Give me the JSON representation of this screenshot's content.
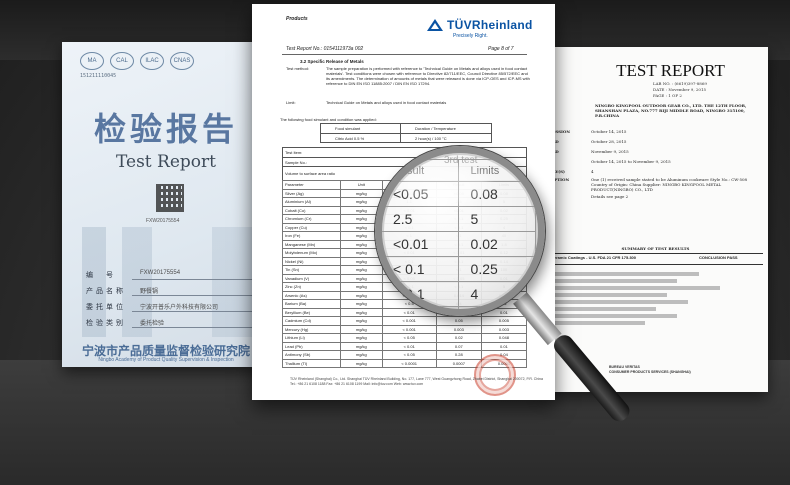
{
  "left_doc": {
    "ma_text": "151211110045",
    "logos": [
      "MA",
      "CAL",
      "ILAC",
      "CNAS"
    ],
    "title_cn": "检验报告",
    "title_en": "Test Report",
    "qr_code": "FXW20175554",
    "form": [
      {
        "label": "编　号",
        "value": "FXW20175554"
      },
      {
        "label": "产品名称",
        "value": "野餐锅"
      },
      {
        "label": "委托单位",
        "value": "宁波开普乐户外科技有限公司"
      },
      {
        "label": "检验类别",
        "value": "委托检验"
      }
    ],
    "org_cn": "宁波市产品质量监督检验研究院",
    "org_en": "Ningbo Academy of Product Quality Supervision & Inspection"
  },
  "center_doc": {
    "products_label": "Products",
    "brand": "TÜVRheinland",
    "slogan": "Precisely Right.",
    "report_no": "Test Report No.: 0154111973a 002",
    "page": "Page 8 of 7",
    "section": "3.2      Specific Release of Metals",
    "test_method_key": "Test method:",
    "test_method_val": "The sample preparation is performed with reference to 'Technical Guide on Metals and alloys used in food contact materials'. Test conditions were chosen with reference to Directive 82/711/EEC, Council Directive 85/572/EEC and its amendments. The determination of amounts of metals that were released is done via ICP-OES and ICP-MS with reference to DIN EN ISO 11885:2007 / DIN EN ISO 17294.",
    "limit_key": "Limit:",
    "limit_val": "Technical Guide on Metals and alloys used in food contact materials",
    "conditions_intro": "The following food simulant and condition was applied:",
    "cond_head": [
      "Food simulant",
      "Duration / Temperature"
    ],
    "cond_row": [
      "Citric Acid 0.5 %",
      "2 hour(s) / 100 °C"
    ],
    "meta_rows": [
      "Test Item:",
      "Sample No.:",
      "Volume to surface area ratio"
    ],
    "res_head": [
      "Parameter",
      "Unit",
      "",
      "Result",
      "Limits"
    ],
    "res_rows": [
      [
        "Silver (Ag)",
        "mg/kg",
        "< 0.01",
        "<0.05",
        "0.08"
      ],
      [
        "Aluminium (Al)",
        "mg/kg",
        "1.1",
        "2.5",
        "5"
      ],
      [
        "Cobalt (Co)",
        "mg/kg",
        "< 0.01",
        "<0.01",
        "0.02"
      ],
      [
        "Chromium (Cr)",
        "mg/kg",
        "< 0.1",
        "< 0.1",
        "0.25"
      ],
      [
        "Copper (Cu)",
        "mg/kg",
        "< 0.1",
        "< 0.1",
        "4"
      ],
      [
        "Iron (Fe)",
        "mg/kg",
        "< 1",
        "< 1",
        "40"
      ],
      [
        "Manganese (Mn)",
        "mg/kg",
        "< 0.1",
        "< 0.1",
        "1.8"
      ],
      [
        "Molybdenum (Mo)",
        "mg/kg",
        "< 0.01",
        "< 0.01",
        "0.12"
      ],
      [
        "Nickel (Ni)",
        "mg/kg",
        "< 0.1",
        "< 0.1",
        "0.14"
      ],
      [
        "Tin (Sn)",
        "mg/kg",
        "< 1",
        "< 1",
        "100"
      ],
      [
        "Vanadium (V)",
        "mg/kg",
        "< 0.05",
        "< 0.05",
        "0.01"
      ],
      [
        "Zinc (Zn)",
        "mg/kg",
        "< 0.1",
        "< 0.1",
        "5"
      ],
      [
        "Arsenic (As)",
        "mg/kg",
        "< 0.005",
        "0.014",
        "0.002"
      ],
      [
        "Barium (Ba)",
        "mg/kg",
        "< 0.5",
        "6.4",
        "1.2"
      ],
      [
        "Beryllium (Be)",
        "mg/kg",
        "< 0.01",
        "0.07",
        "0.01"
      ],
      [
        "Cadmium (Cd)",
        "mg/kg",
        "< 0.001",
        "0.05",
        "0.005"
      ],
      [
        "Mercury (Hg)",
        "mg/kg",
        "< 0.001",
        "0.003",
        "0.003"
      ],
      [
        "Lithium (Li)",
        "mg/kg",
        "< 0.05",
        "0.02",
        "0.048"
      ],
      [
        "Lead (Pb)",
        "mg/kg",
        "< 0.01",
        "0.07",
        "0.01"
      ],
      [
        "Antimony (Sb)",
        "mg/kg",
        "< 0.05",
        "0.28",
        "0.04"
      ],
      [
        "Thallium (Tl)",
        "mg/kg",
        "< 0.0001",
        "0.0007",
        "0.0001"
      ]
    ],
    "footer": "TÜV Rheinland (Shanghai) Co., Ltd. Shanghai TÜV Rheinland Building, No. 177, Lane 777, West Guangzhong Road, Zhabei District, Shanghai 200072, P.R. China",
    "footer2": "Tel.: +86 21 6108 1188    Fax: +86 21 6108 1199    Mail: info@tuv.com    Web: www.tuv.com"
  },
  "lens": {
    "third_test": "3rd test",
    "unit_note": "*1)",
    "head": [
      "Result",
      "Limits"
    ],
    "rows": [
      [
        "<0.05",
        "0.08"
      ],
      [
        "2.5",
        "5"
      ],
      [
        "<0.01",
        "0.02"
      ],
      [
        "< 0.1",
        "0.25"
      ],
      [
        "< 0.1",
        "4"
      ],
      [
        "< 1",
        "40"
      ]
    ]
  },
  "right_doc": {
    "title": "TEST REPORT",
    "lab_no": "LAB NO. :  (6619)397-8869",
    "date": "DATE :  November 9, 2015",
    "page": "PAGE :  1 OF 2",
    "header": "NINGBO KINGPOOL OUTDOOR GEAR CO., LTD. THE 12TH FLOOR, SHANSHAN PLAZA, NO.777 RIJI MIDDLE ROAD, NINGBO 315100, P.R.CHINA",
    "rows": [
      {
        "k": "MISSION",
        "v": "October 14, 2015"
      },
      {
        "k": "OLD",
        "v": "October 28, 2015"
      },
      {
        "k": "OLD",
        "v": "November 9, 2015"
      },
      {
        "k": "",
        "v": "October 14, 2015 to November 9, 2015"
      },
      {
        "k": "DAY(S)",
        "v": "4"
      },
      {
        "k": "RIPTION",
        "v": "One (1) received sample stated to be Aluminum cookware  Style No.: CW-508  Country of Origin: China  Supplier: NINGBO KINGPOOL METAL PRODUCT(NINGBO) CO., LTD"
      },
      {
        "k": "",
        "v": "Details see page 2"
      }
    ],
    "summary_title": "SUMMARY OF TEST RESULTS",
    "summary_left": "Ceramic Coatings - U.S. FDA 21 CFR 175.300",
    "summary_right": "CONCLUSION  PASS",
    "sv1": "BUREAU VERITAS",
    "sv2": "CONSUMER PRODUCTS SERVICES (SHANGHAI)"
  }
}
